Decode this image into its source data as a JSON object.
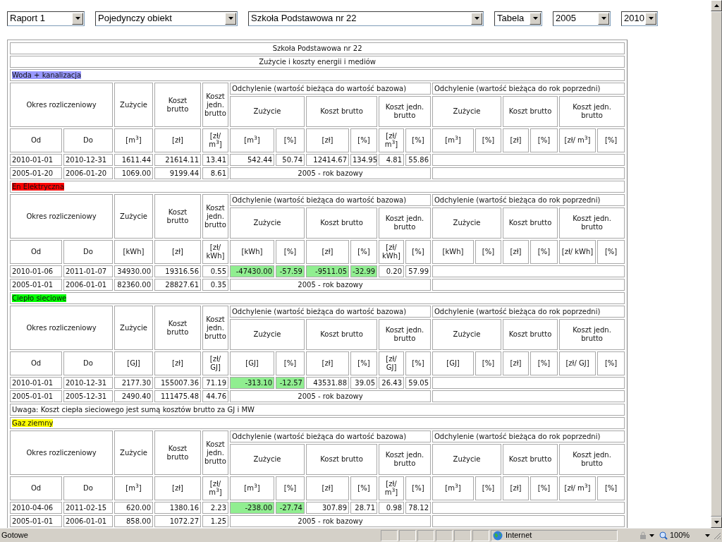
{
  "toolbar": {
    "selects": [
      {
        "value": "Raport 1"
      },
      {
        "value": "Pojedynczy obiekt"
      },
      {
        "value": "Szkoła Podstawowa nr 22"
      },
      {
        "value": "Tabela"
      },
      {
        "value": "2005"
      },
      {
        "value": "2010"
      }
    ]
  },
  "table": {
    "title": "Szkoła Podstawowa nr 22",
    "subtitle": "Zużycie i koszty energii i mediów",
    "sections": [
      {
        "name": "Woda + kanalizacja",
        "color": "#9999ff",
        "header": {
          "period": "Okres rozliczeniowy",
          "consumption": "Zużycie",
          "gross": "Koszt brutto",
          "unit": "Koszt jedn. brutto",
          "dev_base": "Odchylenie (wartość bieżąca do wartość bazowa)",
          "dev_prev": "Odchylenie (wartość bieżąca do rok poprzedni)",
          "dev_base_cols": [
            "Zużycie",
            "Koszt brutto",
            "Koszt jedn. brutto"
          ],
          "dev_prev_cols": [
            "Zużycie",
            "Koszt brutto",
            "Koszt jedn. brutto"
          ]
        },
        "unit_row": [
          "Od",
          "Do",
          "[m$^{3}$]",
          "[zł]",
          "[zł/ m$^{3}$]",
          "[m$^{3}$]",
          "[%]",
          "[zł]",
          "[%]",
          "[zł/ m$^{3}$]",
          "[%]",
          "[m$^{3}$]",
          "[%]",
          "[zł]",
          "[%]",
          "[zł/ m$^{3}$]",
          "[%]"
        ],
        "rows": [
          {
            "kind": "current",
            "cells": [
              "2010-01-01",
              "2010-12-31",
              "1611.44",
              "21614.11",
              "13.41"
            ],
            "deviation": [
              {
                "value": "542.44",
                "highlighted": false
              },
              {
                "value": "50.74",
                "highlighted": false
              },
              {
                "value": "12414.67",
                "highlighted": false
              },
              {
                "value": "134.95",
                "highlighted": false
              },
              {
                "value": "4.81",
                "highlighted": false
              },
              {
                "value": "55.86",
                "highlighted": false
              }
            ]
          },
          {
            "kind": "base",
            "cells": [
              "2005-01-20",
              "2006-01-20",
              "1069.00",
              "9199.44",
              "8.61"
            ],
            "base_label": "2005 - rok bazowy"
          }
        ]
      },
      {
        "name": "En Elektryczna",
        "color": "#ff0000",
        "header": {
          "period": "Okres rozliczeniowy",
          "consumption": "Zużycie",
          "gross": "Koszt brutto",
          "unit": "Koszt jedn. brutto",
          "dev_base": "Odchylenie (wartość bieżąca do wartość bazowa)",
          "dev_prev": "Odchylenie (wartość bieżąca do rok poprzedni)",
          "dev_base_cols": [
            "Zużycie",
            "Koszt brutto",
            "Koszt jedn. brutto"
          ],
          "dev_prev_cols": [
            "Zużycie",
            "Koszt brutto",
            "Koszt jedn. brutto"
          ]
        },
        "unit_row": [
          "Od",
          "Do",
          "[kWh]",
          "[zł]",
          "[zł/ kWh]",
          "[kWh]",
          "[%]",
          "[zł]",
          "[%]",
          "[zł/ kWh]",
          "[%]",
          "[kWh]",
          "[%]",
          "[zł]",
          "[%]",
          "[zł/ kWh]",
          "[%]"
        ],
        "rows": [
          {
            "kind": "current",
            "cells": [
              "2010-01-06",
              "2011-01-07",
              "34930.00",
              "19316.56",
              "0.55"
            ],
            "deviation": [
              {
                "value": "-47430.00",
                "highlighted": true
              },
              {
                "value": "-57.59",
                "highlighted": true
              },
              {
                "value": "-9511.05",
                "highlighted": true
              },
              {
                "value": "-32.99",
                "highlighted": true
              },
              {
                "value": "0.20",
                "highlighted": false
              },
              {
                "value": "57.99",
                "highlighted": false
              }
            ]
          },
          {
            "kind": "base",
            "cells": [
              "2005-01-01",
              "2006-01-01",
              "82360.00",
              "28827.61",
              "0.35"
            ],
            "base_label": "2005 - rok bazowy"
          }
        ]
      },
      {
        "name": "Ciepło sieciowe",
        "color": "#00ff00",
        "header": {
          "period": "Okres rozliczeniowy",
          "consumption": "Zużycie",
          "gross": "Koszt brutto",
          "unit": "Koszt jedn. brutto",
          "dev_base": "Odchylenie (wartość bieżąca do wartość bazowa)",
          "dev_prev": "Odchylenie (wartość bieżąca do rok poprzedni)",
          "dev_base_cols": [
            "Zużycie",
            "Koszt brutto",
            "Koszt jedn. brutto"
          ],
          "dev_prev_cols": [
            "Zużycie",
            "Koszt brutto",
            "Koszt jedn. brutto"
          ]
        },
        "unit_row": [
          "Od",
          "Do",
          "[GJ]",
          "[zł]",
          "[zł/ GJ]",
          "[GJ]",
          "[%]",
          "[zł]",
          "[%]",
          "[zł/ GJ]",
          "[%]",
          "[GJ]",
          "[%]",
          "[zł]",
          "[%]",
          "[zł/ GJ]",
          "[%]"
        ],
        "rows": [
          {
            "kind": "current",
            "cells": [
              "2010-01-01",
              "2010-12-31",
              "2177.30",
              "155007.36",
              "71.19"
            ],
            "deviation": [
              {
                "value": "-313.10",
                "highlighted": true
              },
              {
                "value": "-12.57",
                "highlighted": true
              },
              {
                "value": "43531.88",
                "highlighted": false
              },
              {
                "value": "39.05",
                "highlighted": false
              },
              {
                "value": "26.43",
                "highlighted": false
              },
              {
                "value": "59.05",
                "highlighted": false
              }
            ]
          },
          {
            "kind": "base",
            "cells": [
              "2005-01-01",
              "2005-12-31",
              "2490.40",
              "111475.48",
              "44.76"
            ],
            "base_label": "2005 - rok bazowy"
          }
        ],
        "note": "Uwaga: Koszt ciepła sieciowego jest sumą kosztów brutto za GJ i MW"
      },
      {
        "name": "Gaz ziemny",
        "color": "#ffff00",
        "header": {
          "period": "Okres rozliczeniowy",
          "consumption": "Zużycie",
          "gross": "Koszt brutto",
          "unit": "Koszt jedn. brutto",
          "dev_base": "Odchylenie (wartość bieżąca do wartość bazowa)",
          "dev_prev": "Odchylenie (wartość bieżąca do rok poprzedni)",
          "dev_base_cols": [
            "Zużycie",
            "Koszt brutto",
            "Koszt jedn. brutto"
          ],
          "dev_prev_cols": [
            "Zużycie",
            "Koszt brutto",
            "Koszt jedn. brutto"
          ]
        },
        "unit_row": [
          "Od",
          "Do",
          "[m$^{3}$]",
          "[zł]",
          "[zł/ m$^{3}$]",
          "[m$^{3}$]",
          "[%]",
          "[zł]",
          "[%]",
          "[zł/ m$^{3}$]",
          "[%]",
          "[m$^{3}$]",
          "[%]",
          "[zł]",
          "[%]",
          "[zł/ m$^{3}$]",
          "[%]"
        ],
        "rows": [
          {
            "kind": "current",
            "cells": [
              "2010-04-06",
              "2011-02-15",
              "620.00",
              "1380.16",
              "2.23"
            ],
            "deviation": [
              {
                "value": "-238.00",
                "highlighted": true
              },
              {
                "value": "-27.74",
                "highlighted": true
              },
              {
                "value": "307.89",
                "highlighted": false
              },
              {
                "value": "28.71",
                "highlighted": false
              },
              {
                "value": "0.98",
                "highlighted": false
              },
              {
                "value": "78.12",
                "highlighted": false
              }
            ]
          },
          {
            "kind": "base",
            "cells": [
              "2005-01-01",
              "2006-01-01",
              "858.00",
              "1072.27",
              "1.25"
            ],
            "base_label": "2005 - rok bazowy"
          }
        ]
      }
    ]
  },
  "status_bar": {
    "status": "Gotowe",
    "zone": "Internet",
    "zoom": "100%"
  }
}
